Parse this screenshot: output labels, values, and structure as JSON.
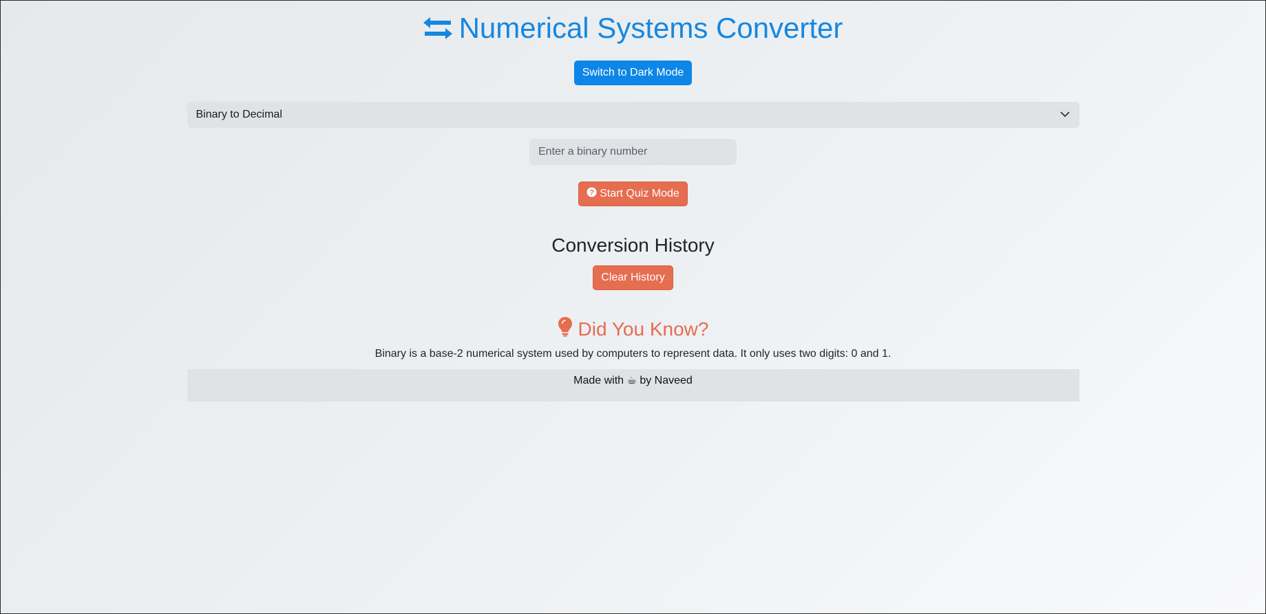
{
  "header": {
    "title": "Numerical Systems Converter",
    "title_icon": "exchange-arrows-icon",
    "accent_color": "#1687e0"
  },
  "theme_toggle": {
    "label": "Switch to Dark Mode"
  },
  "conversion_select": {
    "selected": "Binary to Decimal"
  },
  "number_input": {
    "value": "",
    "placeholder": "Enter a binary number"
  },
  "quiz": {
    "label": "Start Quiz Mode",
    "icon": "question-circle-icon"
  },
  "history": {
    "title": "Conversion History",
    "clear_label": "Clear History"
  },
  "fact": {
    "title": "Did You Know?",
    "icon": "lightbulb-icon",
    "text": "Binary is a base-2 numerical system used by computers to represent data. It only uses two digits: 0 and 1.",
    "color": "#e56d50"
  },
  "footer": {
    "prefix": "Made with",
    "icon": "☕",
    "suffix": "by Naveed"
  }
}
